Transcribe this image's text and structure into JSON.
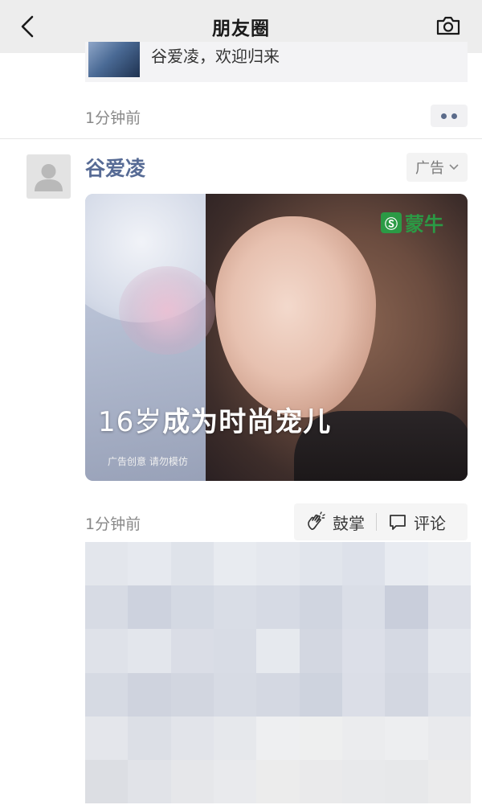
{
  "navbar": {
    "title": "朋友圈",
    "back_icon": "chevron-left-icon",
    "camera_icon": "camera-icon"
  },
  "previous_post": {
    "link_text": "谷爱凌，欢迎归来",
    "time": "1分钟前",
    "more_icon": "more-dots-icon"
  },
  "ad_post": {
    "author": "谷爱凌",
    "ad_tag": "广告",
    "image": {
      "brand_logo_text": "蒙牛",
      "headline_prefix": "16岁",
      "headline_main": "成为时尚宠儿",
      "disclaimer": "广告创意 请勿模仿"
    },
    "time": "1分钟前",
    "actions": {
      "clap_label": "鼓掌",
      "comment_label": "评论"
    }
  },
  "colors": {
    "link_blue": "#576b95",
    "brand_green": "#2b9a45",
    "navbar_bg": "#ededed"
  },
  "mosaic_colors": [
    "#e3e6ec",
    "#e6e9ef",
    "#dfe3ea",
    "#e8ebf0",
    "#e5e8ee",
    "#e1e5ec",
    "#dde1ea",
    "#e8ebf1",
    "#eceef2",
    "#d7dbe4",
    "#cdd2de",
    "#d4d9e3",
    "#d9dde6",
    "#d6dae4",
    "#d0d5e0",
    "#dadee7",
    "#c9cedb",
    "#dde0e8",
    "#dfe2e9",
    "#e3e6ec",
    "#dadde6",
    "#d8dce5",
    "#e6e9ee",
    "#d3d7e1",
    "#dcdfe8",
    "#d5d9e3",
    "#e4e7ed",
    "#d6dae3",
    "#cfd3de",
    "#d2d6e0",
    "#d7dbe4",
    "#d4d8e2",
    "#ced3de",
    "#dbdee7",
    "#d3d7e1",
    "#dfe2e9",
    "#e4e6eb",
    "#dcdfe6",
    "#e2e4ea",
    "#e6e8ec",
    "#eeeff1",
    "#eeefef",
    "#ebecee",
    "#edeef0",
    "#e9eaed",
    "#dcdee3",
    "#e1e3e8",
    "#e6e7ea",
    "#e9eaed",
    "#ececec",
    "#eaeaeb",
    "#e8e9eb",
    "#e7e8ea",
    "#ebebec"
  ]
}
